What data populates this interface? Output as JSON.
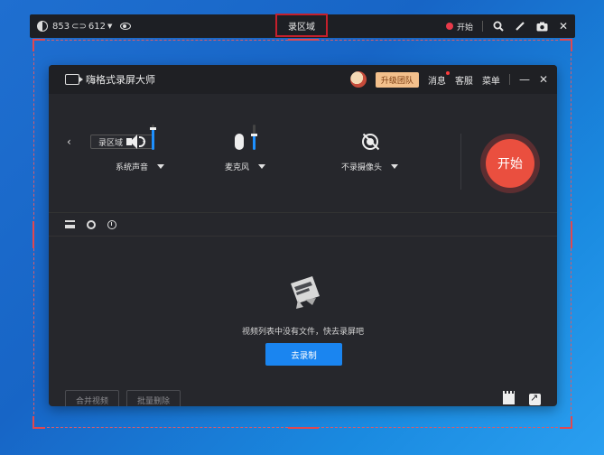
{
  "capture_toolbar": {
    "width_value": "853",
    "link_glyph": "⊂⊃",
    "height_value": "612",
    "region_label": "录区域",
    "start_label": "开始"
  },
  "app": {
    "name": "嗨格式录屏大师",
    "upgrade_label": "升级团队",
    "messages_label": "消息",
    "service_label": "客服",
    "menu_label": "菜单",
    "minimize_glyph": "—",
    "close_glyph": "✕"
  },
  "settings": {
    "back_glyph": "‹",
    "mode_select": "录区域",
    "system_audio": {
      "label": "系统声音",
      "level": 0.85
    },
    "microphone": {
      "label": "麦克风",
      "level": 0.6
    },
    "camera": {
      "label": "不录摄像头"
    },
    "start_button": "开始"
  },
  "list": {
    "empty_text": "视频列表中没有文件，快去录屏吧",
    "goto_record": "去录制",
    "merge_button": "合并视频",
    "batch_delete_button": "批量删除"
  },
  "colors": {
    "accent_blue": "#1a85f0",
    "record_red": "#ea4f3f",
    "frame_red": "#e2474f",
    "upgrade_bg": "#f3c08c"
  }
}
